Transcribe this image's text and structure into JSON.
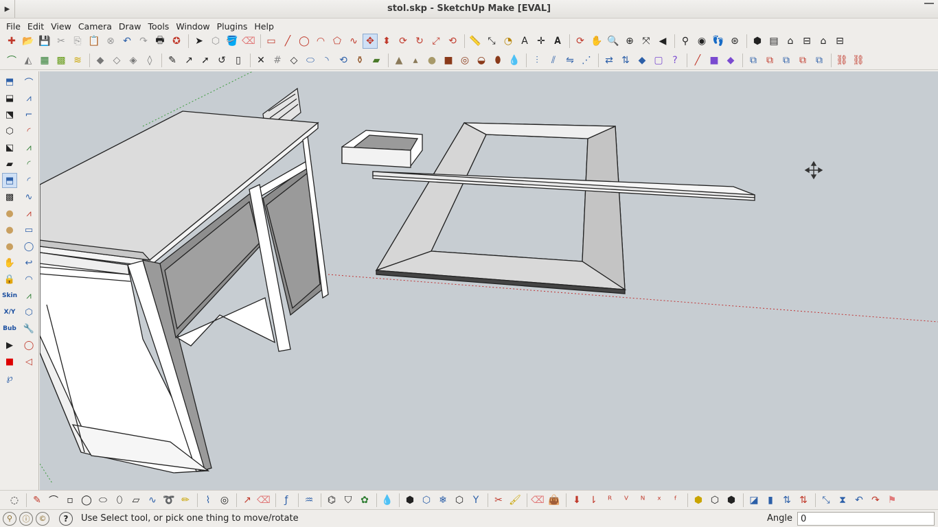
{
  "window": {
    "title": "stol.skp - SketchUp Make [EVAL]"
  },
  "menu": {
    "items": [
      "File",
      "Edit",
      "View",
      "Camera",
      "Draw",
      "Tools",
      "Window",
      "Plugins",
      "Help"
    ]
  },
  "left_tools": {
    "skin_label": "Skin",
    "xyz_label": "X/Y",
    "bub_label": "Bub"
  },
  "status": {
    "message": "Use Select tool, or pick one thing to move/rotate",
    "vcb_label": "Angle",
    "vcb_value": "0",
    "help_icon": "?"
  },
  "colors": {
    "viewport_bg": "#c7cdd2",
    "active_tool": "#cfe0f5"
  }
}
